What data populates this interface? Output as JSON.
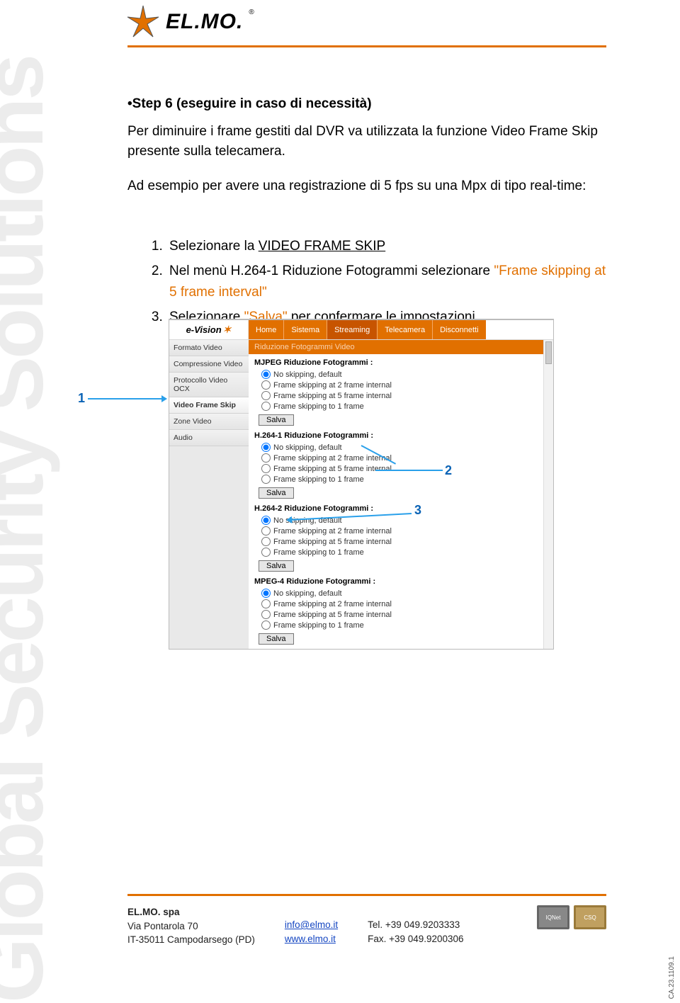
{
  "logo_text": "EL.MO.",
  "watermark": "Global Security Solutions",
  "step_title": "•Step 6 (eseguire in caso di necessità)",
  "intro": "Per diminuire i frame gestiti dal DVR va utilizzata la funzione Video Frame Skip presente sulla telecamera.",
  "example": "Ad esempio per avere una registrazione di 5 fps su una Mpx di tipo real-time:",
  "steps": {
    "s1_a": "Selezionare la ",
    "s1_b": "VIDEO FRAME SKIP",
    "s2_a": "Nel menù H.264-1 Riduzione Fotogrammi selezionare ",
    "s2_b": "\"Frame skipping at 5 frame interval\"",
    "s3_a": "Selezionare ",
    "s3_b": "\"Salva\"",
    "s3_c": " per confermare le impostazioni"
  },
  "callouts": {
    "c1": "1",
    "c2": "2",
    "c3": "3"
  },
  "app": {
    "brand": "e-Vision",
    "tabs": [
      "Home",
      "Sistema",
      "Streaming",
      "Telecamera",
      "Disconnetti"
    ],
    "selected_tab": 2,
    "sidebar": [
      "Formato Video",
      "Compressione Video",
      "Protocollo Video OCX",
      "Video Frame Skip",
      "Zone Video",
      "Audio"
    ],
    "sidebar_selected": 3,
    "panel_header": "Riduzione Fotogrammi Video",
    "groups": [
      {
        "title": "MJPEG Riduzione Fotogrammi :",
        "options": [
          "No skipping, default",
          "Frame skipping at 2 frame internal",
          "Frame skipping at 5 frame internal",
          "Frame skipping to 1 frame"
        ],
        "checked": 0,
        "save": "Salva"
      },
      {
        "title": "H.264-1 Riduzione Fotogrammi :",
        "options": [
          "No skipping, default",
          "Frame skipping at 2 frame internal",
          "Frame skipping at 5 frame internal",
          "Frame skipping to 1 frame"
        ],
        "checked": 0,
        "save": "Salva"
      },
      {
        "title": "H.264-2 Riduzione Fotogrammi :",
        "options": [
          "No skipping, default",
          "Frame skipping at 2 frame internal",
          "Frame skipping at 5 frame internal",
          "Frame skipping to 1 frame"
        ],
        "checked": 0,
        "save": "Salva"
      },
      {
        "title": "MPEG-4 Riduzione Fotogrammi :",
        "options": [
          "No skipping, default",
          "Frame skipping at 2 frame internal",
          "Frame skipping at 5 frame internal",
          "Frame skipping to 1 frame"
        ],
        "checked": 0,
        "save": "Salva"
      }
    ]
  },
  "footer": {
    "company": "EL.MO. spa",
    "addr1": "Via Pontarola 70",
    "addr2": "IT-35011 Campodarsego (PD)",
    "email": "info@elmo.it",
    "site": "www.elmo.it",
    "tel": "Tel. +39 049.9203333",
    "fax": "Fax. +39 049.9200306",
    "badge1": "IQNet",
    "badge2": "CSQ"
  },
  "docref": "CA.23.1109.1"
}
